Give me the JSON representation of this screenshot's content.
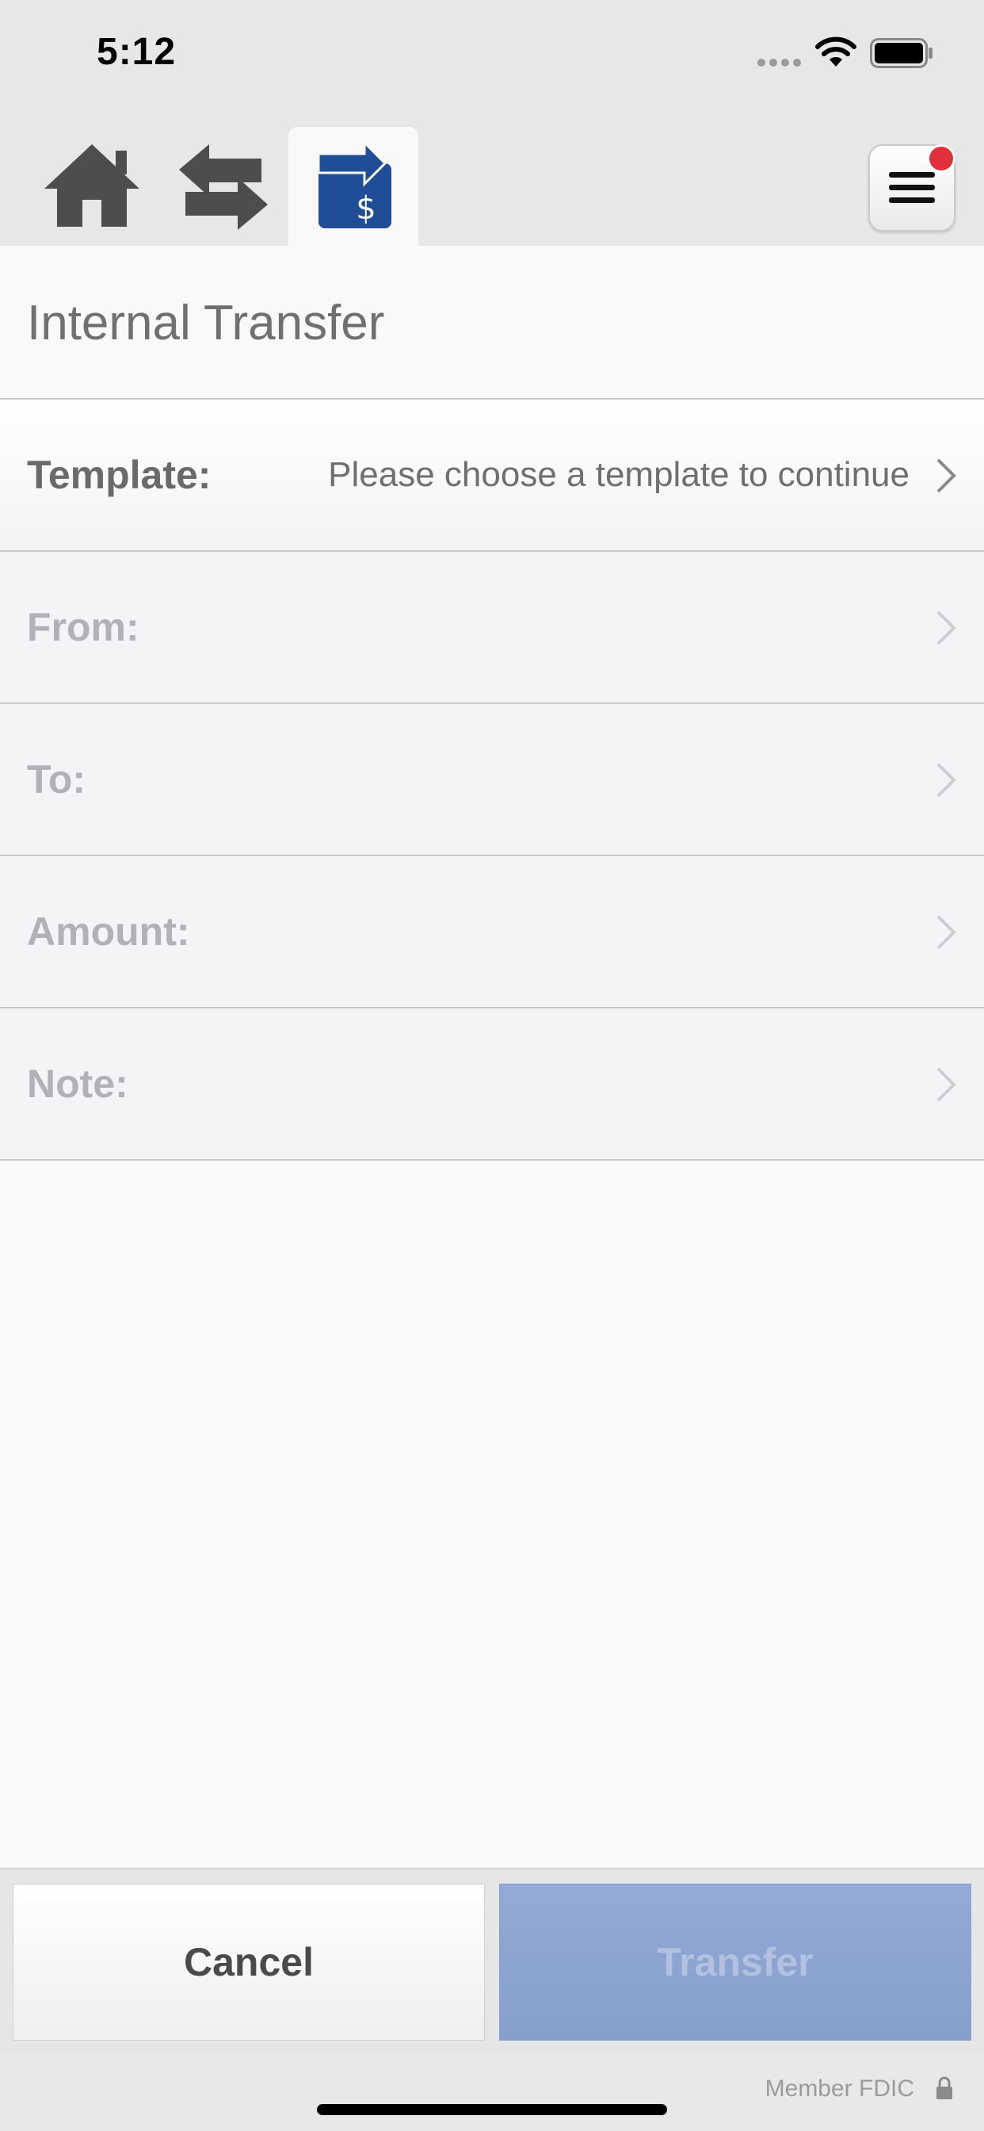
{
  "status_bar": {
    "time": "5:12"
  },
  "nav": {
    "tabs": [
      {
        "icon": "home-icon"
      },
      {
        "icon": "transfer-arrows-icon"
      },
      {
        "icon": "money-transfer-icon",
        "active": true
      }
    ],
    "menu_icon": "hamburger-menu-icon",
    "notification_color": "#e0303c"
  },
  "page": {
    "title": "Internal Transfer"
  },
  "form": {
    "rows": [
      {
        "label": "Template:",
        "value": "Please choose a template to continue"
      },
      {
        "label": "From:",
        "value": ""
      },
      {
        "label": "To:",
        "value": ""
      },
      {
        "label": "Amount:",
        "value": ""
      },
      {
        "label": "Note:",
        "value": ""
      }
    ]
  },
  "actions": {
    "cancel_label": "Cancel",
    "transfer_label": "Transfer"
  },
  "footer": {
    "fdic_label": "Member FDIC"
  },
  "colors": {
    "accent": "#1f4e96",
    "transfer_disabled": "#8ea5d2"
  }
}
